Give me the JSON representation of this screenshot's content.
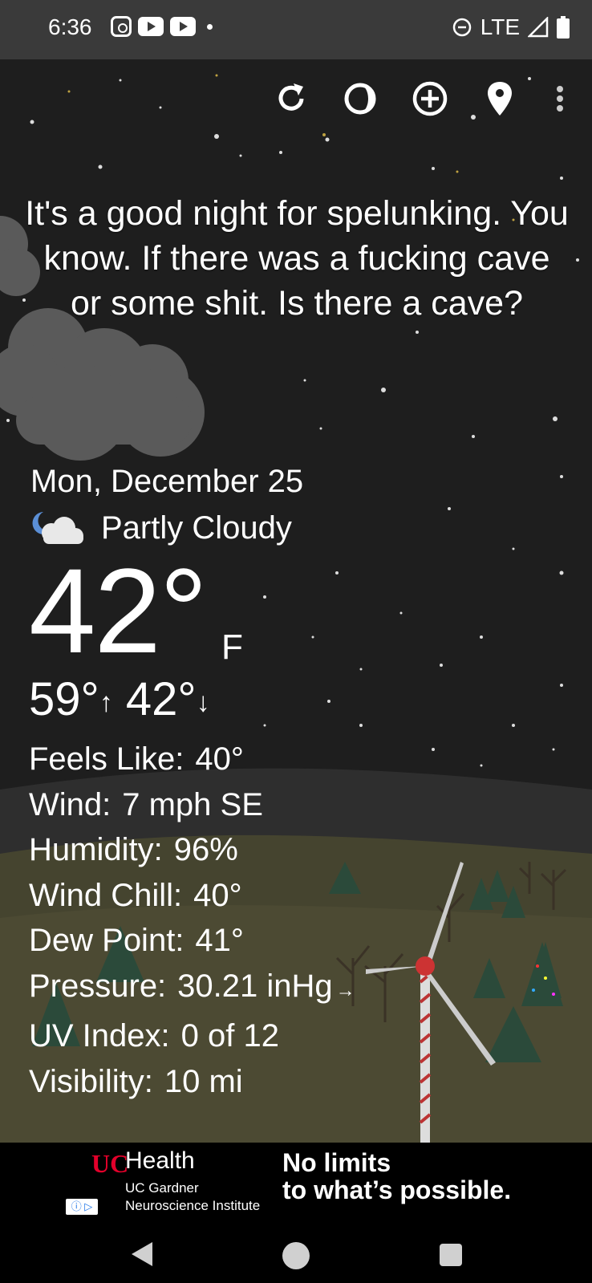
{
  "status_bar": {
    "time": "6:36",
    "network": "LTE"
  },
  "toolbar": {
    "icons": [
      "refresh-icon",
      "theme-circle-icon",
      "add-location-icon",
      "location-pin-icon",
      "more-vert-icon"
    ]
  },
  "quote": "It's a good night for spelunking. You know. If there was a fucking cave or some shit. Is there a cave?",
  "weather": {
    "date": "Mon, December 25",
    "condition": "Partly Cloudy",
    "temperature": "42°",
    "unit": "F",
    "high": "59°",
    "high_arrow": "↑",
    "low": "42°",
    "low_arrow": "↓",
    "details": [
      {
        "label": "Feels Like:",
        "value": "40°"
      },
      {
        "label": "Wind:",
        "value": "7 mph SE"
      },
      {
        "label": "Humidity:",
        "value": "96%"
      },
      {
        "label": "Wind Chill:",
        "value": "40°"
      },
      {
        "label": "Dew Point:",
        "value": "41°"
      },
      {
        "label": "Pressure:",
        "value": "30.21 inHg",
        "trend_arrow": "→"
      },
      {
        "label": "UV Index:",
        "value": "0 of 12"
      },
      {
        "label": "Visibility:",
        "value": "10 mi"
      }
    ]
  },
  "ad": {
    "brand": "Health",
    "sub_line_1": "UC Gardner",
    "sub_line_2": "Neuroscience Institute",
    "headline_1": "No limits",
    "headline_2": "to what’s possible.",
    "badge": "ⓘ ▷",
    "brand_color": "#e4002b"
  },
  "colors": {
    "sky": "#1e1e1e",
    "hills": "#4a4a35"
  }
}
